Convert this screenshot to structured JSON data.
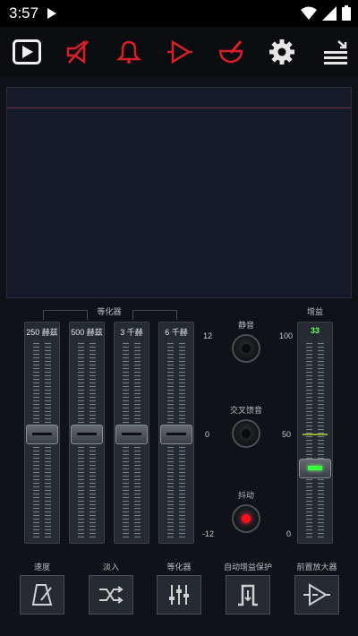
{
  "status_bar": {
    "time": "3:57"
  },
  "toolbar": {
    "icons": [
      "play-icon",
      "speaker-icon",
      "bell-icon",
      "amplifier-icon",
      "mortar-icon",
      "gear-icon",
      "menu-icon"
    ]
  },
  "colors": {
    "accent_red": "#d62027",
    "gain_green": "#3cff3c",
    "knob_red": "#ff1020"
  },
  "equalizer": {
    "title": "等化器",
    "bands": [
      {
        "label": "250 赫兹",
        "value": 0
      },
      {
        "label": "500 赫兹",
        "value": 0
      },
      {
        "label": "3 千赫",
        "value": 0
      },
      {
        "label": "6 千赫",
        "value": 0
      }
    ],
    "scale": {
      "top": "12",
      "mid": "0",
      "bottom": "-12"
    }
  },
  "controls": {
    "mute_label": "静音",
    "crossfeed_label": "交叉馈音",
    "dither_label": "抖动"
  },
  "gain": {
    "title": "增益",
    "value_label": "33",
    "value": 33,
    "scale": {
      "top": "100",
      "mid": "50",
      "bottom": "0"
    }
  },
  "bottom_buttons": [
    {
      "label": "速度",
      "icon": "metronome-icon"
    },
    {
      "label": "淡入",
      "icon": "crossfade-icon"
    },
    {
      "label": "等化器",
      "icon": "equalizer-icon"
    },
    {
      "label": "自动增益保护",
      "icon": "limiter-icon"
    },
    {
      "label": "前置放大器",
      "icon": "preamp-icon"
    }
  ]
}
